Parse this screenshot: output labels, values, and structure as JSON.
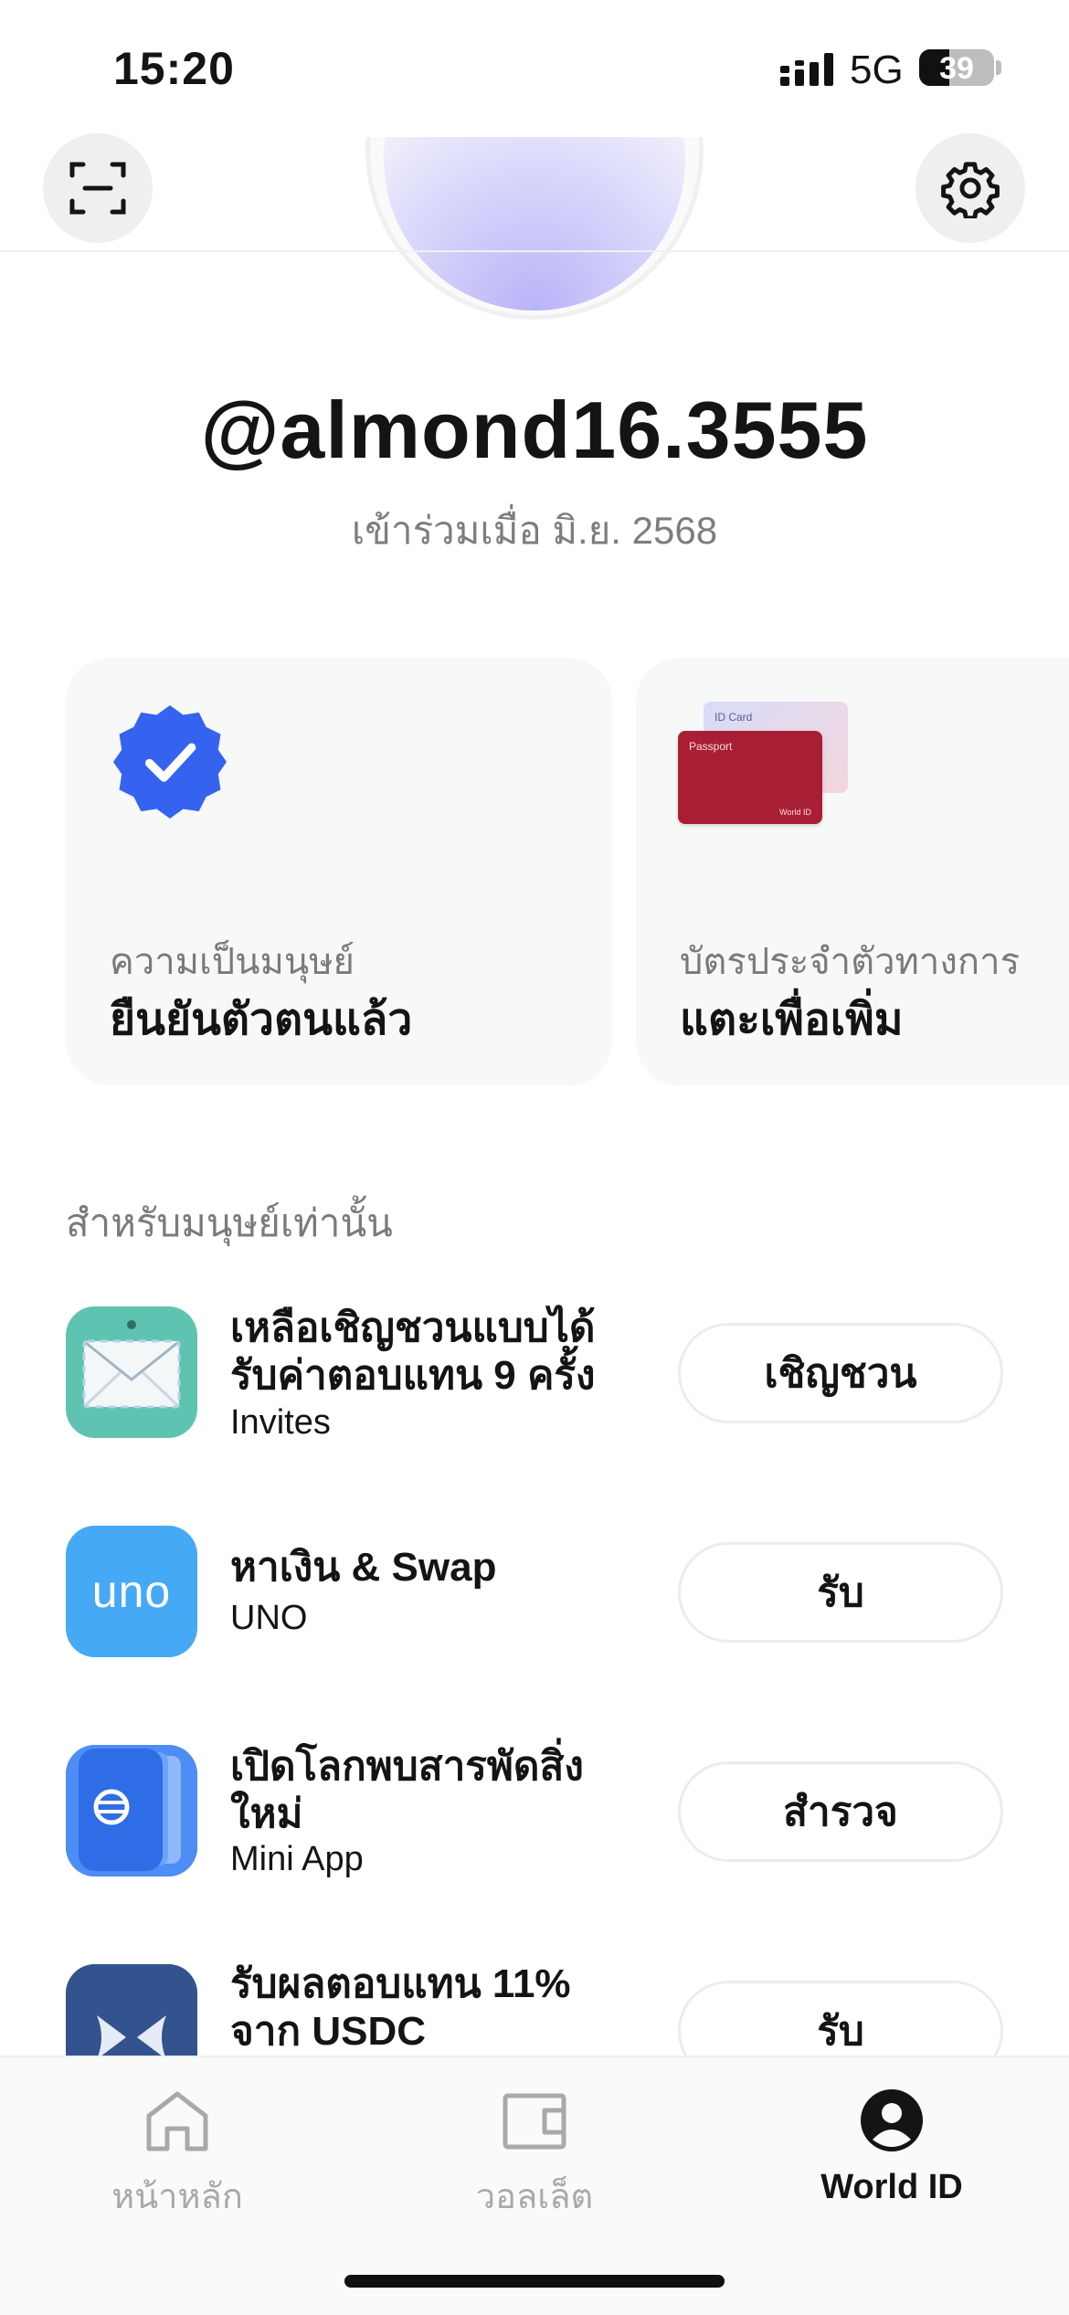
{
  "status_bar": {
    "time": "15:20",
    "network": "5G",
    "battery": "39"
  },
  "profile": {
    "username": "@almond16.3555",
    "joined": "เข้าร่วมเมื่อ มิ.ย. 2568"
  },
  "cards": [
    {
      "subtitle": "ความเป็นมนุษย์",
      "title": "ยืนยันตัวตนแล้ว"
    },
    {
      "subtitle": "บัตรประจำตัวทางการ",
      "title": "แตะเพื่อเพิ่ม",
      "id_card_label": "ID Card",
      "passport_label": "Passport",
      "passport_brand": "World ID"
    }
  ],
  "section": {
    "title": "สำหรับมนุษย์เท่านั้น"
  },
  "rows": [
    {
      "title": "เหลือเชิญชวนแบบได้รับค่าตอบแทน 9 ครั้ง",
      "subtitle": "Invites",
      "button": "เชิญชวน",
      "icon": "envelope-icon"
    },
    {
      "title": "หาเงิน & Swap",
      "subtitle": "UNO",
      "button": "รับ",
      "icon": "uno-logo",
      "logo_text": "uno"
    },
    {
      "title": "เปิดโลกพบสารพัดสิ่งใหม่",
      "subtitle": "Mini App",
      "button": "สำรวจ",
      "icon": "mini-app-book-icon"
    },
    {
      "title": "รับผลตอบแทน 11% จาก USDC",
      "subtitle": "",
      "button": "รับ",
      "icon": "bow-tie-icon"
    }
  ],
  "nav": [
    {
      "label": "หน้าหลัก",
      "icon": "home-icon",
      "active": false
    },
    {
      "label": "วอลเล็ต",
      "icon": "wallet-icon",
      "active": false
    },
    {
      "label": "World ID",
      "icon": "person-icon",
      "active": true
    }
  ],
  "colors": {
    "accent": "#3563f0",
    "inactive": "#a9a9a9",
    "text": "#141414"
  }
}
